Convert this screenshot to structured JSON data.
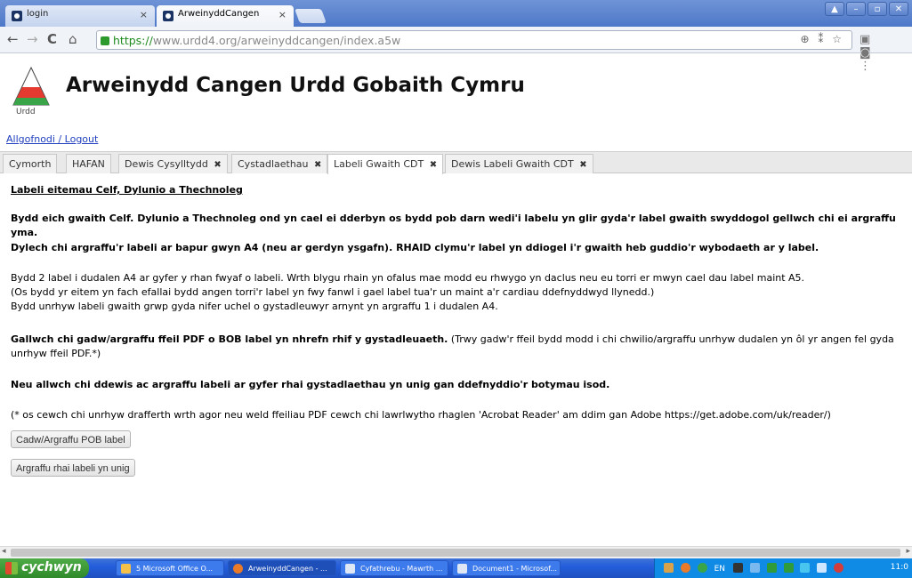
{
  "browser": {
    "tabs": [
      {
        "label": "login",
        "close": "×"
      },
      {
        "label": "ArweinyddCangen",
        "close": "×"
      }
    ],
    "window_buttons": [
      "▲",
      "–",
      "▫",
      "✕"
    ],
    "nav": {
      "back": "←",
      "forward": "→",
      "reload": "C",
      "home": "⌂"
    },
    "url_https": "https://",
    "url_rest": "www.urdd4.org/arweinyddcangen/index.a5w"
  },
  "header": {
    "logo_text": "Urdd",
    "title": "Arweinydd Cangen Urdd Gobaith Cymru",
    "logout": "Allgofnodi / Logout"
  },
  "app_tabs": [
    {
      "label": "Cymorth",
      "close": ""
    },
    {
      "label": "HAFAN",
      "close": ""
    },
    {
      "label": "Dewis Cysylltydd",
      "close": "✖"
    },
    {
      "label": "Cystadlaethau",
      "close": "✖"
    },
    {
      "label": "Labeli Gwaith CDT",
      "close": "✖"
    },
    {
      "label": "Dewis Labeli Gwaith CDT",
      "close": "✖"
    }
  ],
  "content": {
    "heading": "Labeli eitemau Celf, Dylunio a Thechnoleg",
    "p1": "Bydd eich gwaith Celf. Dylunio a Thechnoleg ond yn cael ei dderbyn os bydd pob darn wedi'i labelu yn glir gyda'r label gwaith swyddogol gellwch chi ei argraffu yma.",
    "p2": "Dylech chi argraffu'r labeli ar bapur gwyn A4 (neu ar gerdyn ysgafn). RHAID clymu'r label yn ddiogel i'r gwaith heb guddio'r wybodaeth ar y label.",
    "p3_line1": "Bydd 2 label i dudalen A4 ar gyfer y rhan fwyaf o labeli. Wrth blygu rhain yn ofalus mae modd eu rhwygo yn daclus neu eu torri er mwyn cael dau label maint A5.",
    "p3_line2": "(Os bydd yr eitem yn fach efallai bydd angen torri'r label yn fwy fanwl i gael label tua'r un maint a'r cardiau ddefnyddwyd llynedd.)",
    "p3_line3": "Bydd unrhyw labeli gwaith grwp gyda nifer uchel o gystadleuwyr arnynt yn argraffu 1 i dudalen A4.",
    "p4_bold": "Gallwch chi gadw/argraffu ffeil PDF o BOB label yn nhrefn rhif y gystadleuaeth.",
    "p4_rest": " (Trwy gadw'r ffeil bydd modd i chi chwilio/argraffu unrhyw dudalen yn ôl yr angen fel gyda unrhyw ffeil PDF.*)",
    "p5": "Neu allwch chi ddewis ac argraffu labeli ar gyfer rhai gystadlaethau yn unig gan ddefnyddio'r botymau isod.",
    "p6": "(* os cewch chi unrhyw drafferth wrth agor neu weld ffeiliau PDF cewch chi lawrlwytho rhaglen 'Acrobat Reader' am ddim gan Adobe https://get.adobe.com/uk/reader/)",
    "btn_all": "Cadw/Argraffu POB label",
    "btn_some": "Argraffu rhai labeli yn unig"
  },
  "taskbar": {
    "start": "cychwyn",
    "tasks": [
      "5 Microsoft Office O...",
      "ArweinyddCangen - ...",
      "Cyfathrebu - Mawrth ...",
      "Document1 - Microsof..."
    ],
    "lang": "EN",
    "clock": "11:0"
  }
}
